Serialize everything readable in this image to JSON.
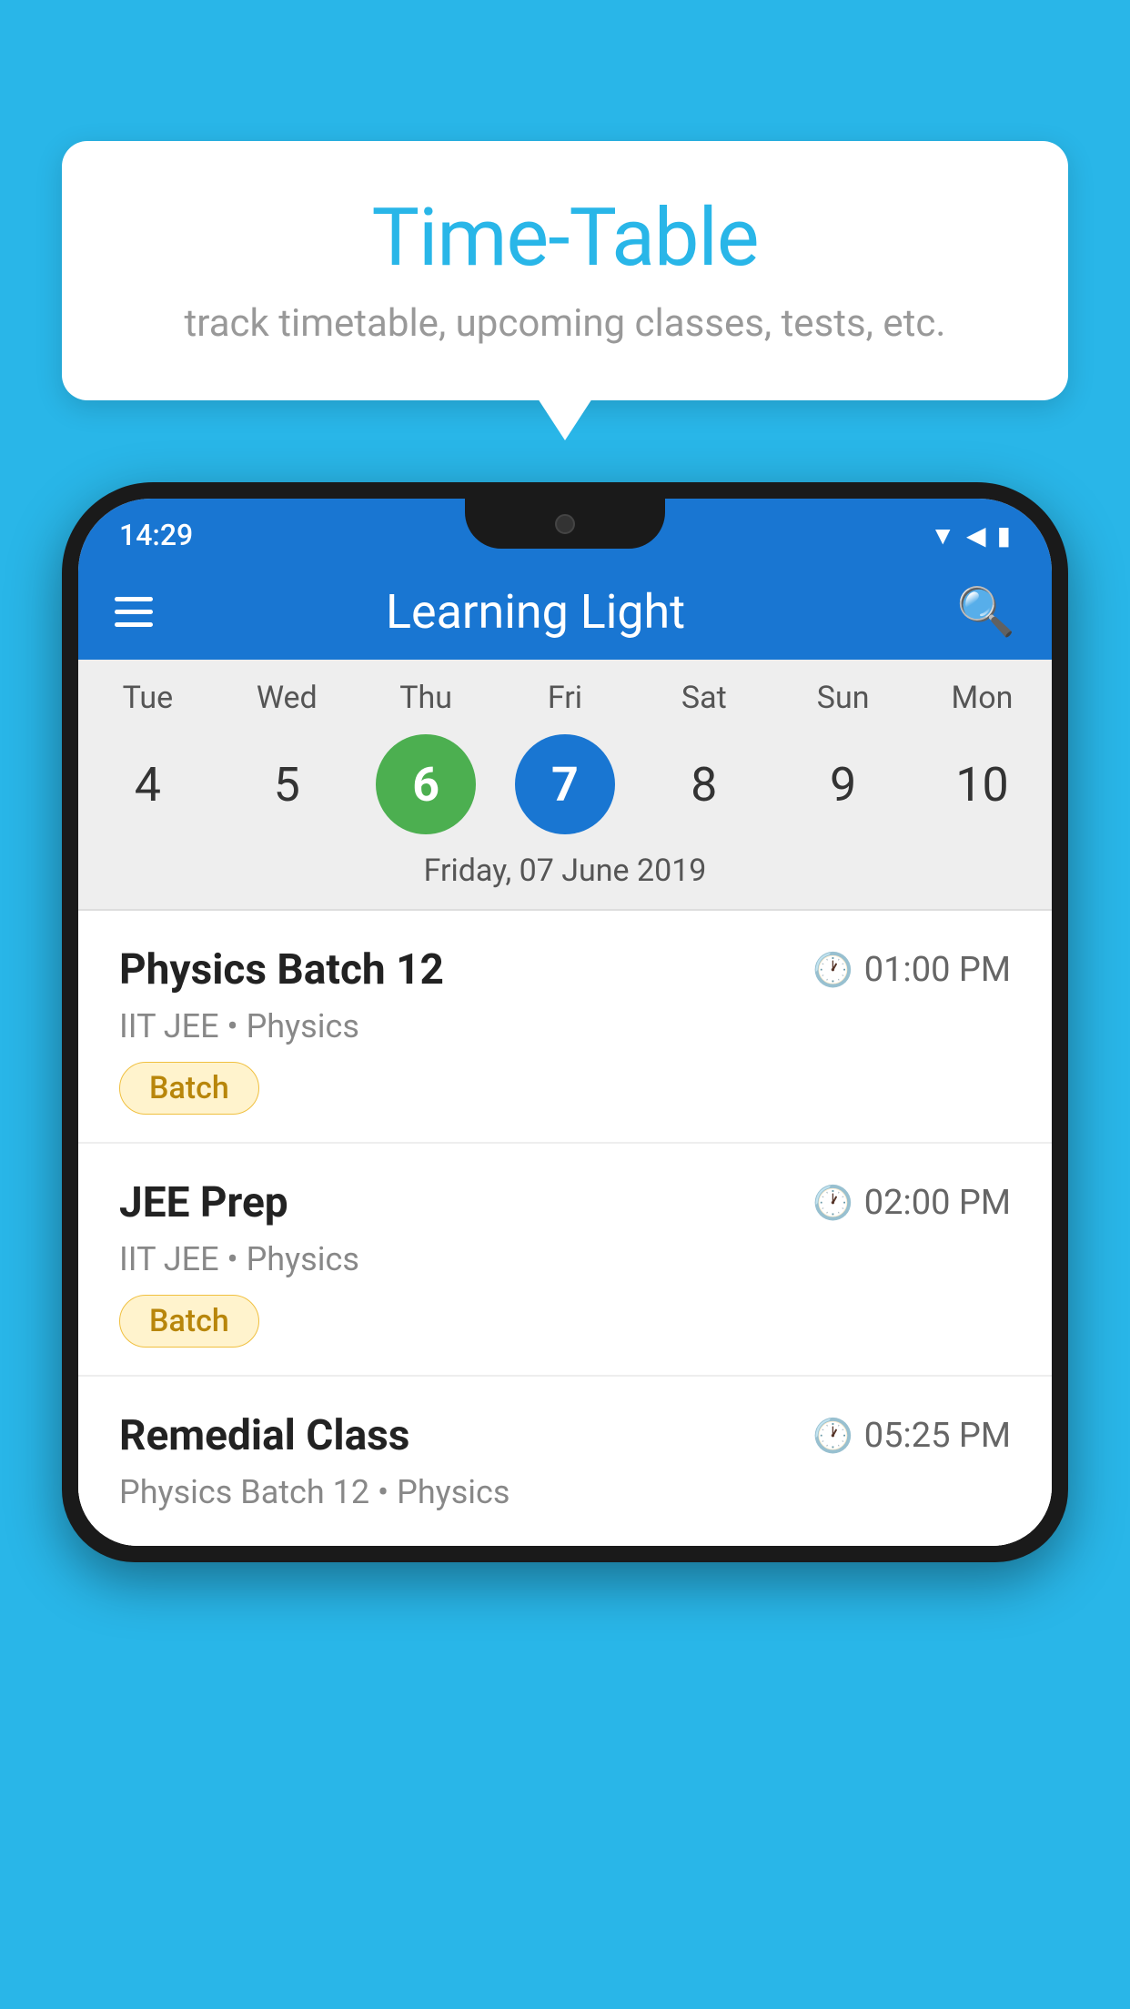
{
  "background": {
    "color": "#29b6e8"
  },
  "tooltip": {
    "title": "Time-Table",
    "subtitle": "track timetable, upcoming classes, tests, etc."
  },
  "phone": {
    "status_bar": {
      "time": "14:29"
    },
    "app_bar": {
      "title": "Learning Light"
    },
    "calendar": {
      "days": [
        "Tue",
        "Wed",
        "Thu",
        "Fri",
        "Sat",
        "Sun",
        "Mon"
      ],
      "dates": [
        "4",
        "5",
        "6",
        "7",
        "8",
        "9",
        "10"
      ],
      "today_index": 2,
      "selected_index": 3,
      "selected_label": "Friday, 07 June 2019"
    },
    "classes": [
      {
        "name": "Physics Batch 12",
        "time": "01:00 PM",
        "meta": "IIT JEE • Physics",
        "tag": "Batch"
      },
      {
        "name": "JEE Prep",
        "time": "02:00 PM",
        "meta": "IIT JEE • Physics",
        "tag": "Batch"
      },
      {
        "name": "Remedial Class",
        "time": "05:25 PM",
        "meta": "Physics Batch 12 • Physics",
        "tag": null
      }
    ]
  }
}
